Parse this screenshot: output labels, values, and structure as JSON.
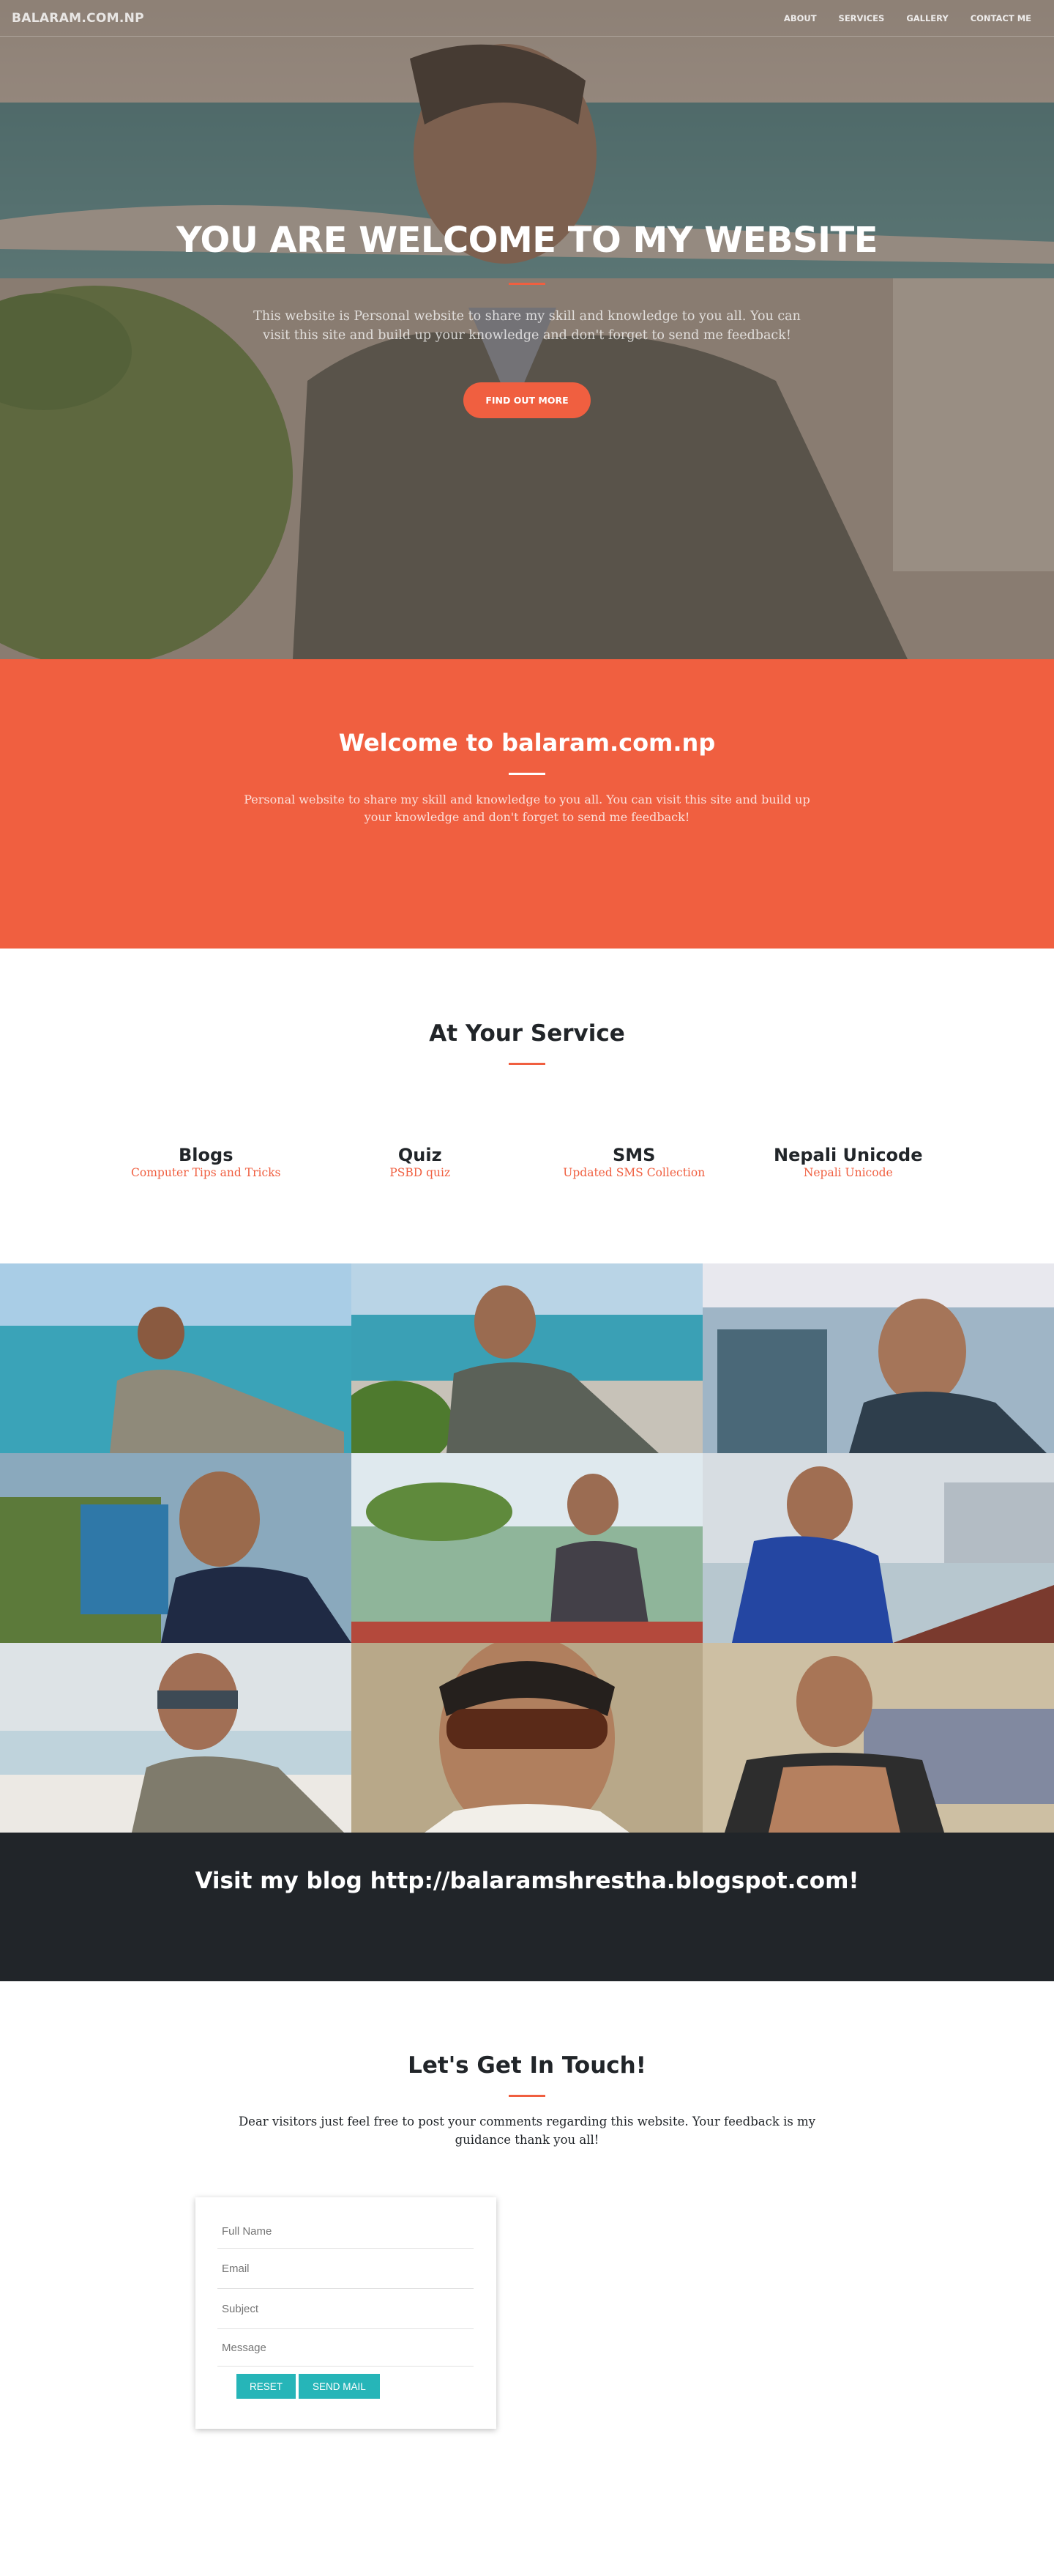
{
  "navbar": {
    "brand": "BALARAM.COM.NP",
    "links": [
      "ABOUT",
      "SERVICES",
      "GALLERY",
      "CONTACT ME"
    ]
  },
  "hero": {
    "title": "YOU ARE WELCOME TO MY WEBSITE",
    "text": "This website is Personal website to share my skill and knowledge to you all. You can visit this site and build up your knowledge and don't forget to send me feedback!",
    "button": "FIND OUT MORE"
  },
  "welcome": {
    "title": "Welcome to balaram.com.np",
    "text": "Personal website to share my skill and knowledge to you all. You can visit this site and build up your knowledge and don't forget to send me feedback!"
  },
  "services": {
    "title": "At Your Service",
    "items": [
      {
        "name": "Blogs",
        "desc": "Computer Tips and Tricks"
      },
      {
        "name": "Quiz",
        "desc": "PSBD quiz"
      },
      {
        "name": "SMS",
        "desc": "Updated SMS Collection"
      },
      {
        "name": "Nepali Unicode",
        "desc": "Nepali Unicode"
      }
    ]
  },
  "blog_banner": {
    "text": "Visit my blog http://balaramshrestha.blogspot.com!"
  },
  "contact": {
    "title": "Let's Get In Touch!",
    "text": "Dear visitors just feel free to post your comments regarding this website. Your feedback is my guidance thank you all!",
    "form": {
      "full_name": "Full Name",
      "email": "Email",
      "subject": "Subject",
      "message": "Message",
      "reset": "RESET",
      "send": "SEND MAIL"
    }
  },
  "colors": {
    "primary": "#f05f40",
    "dark": "#212529",
    "form_button": "#26b5b8"
  }
}
